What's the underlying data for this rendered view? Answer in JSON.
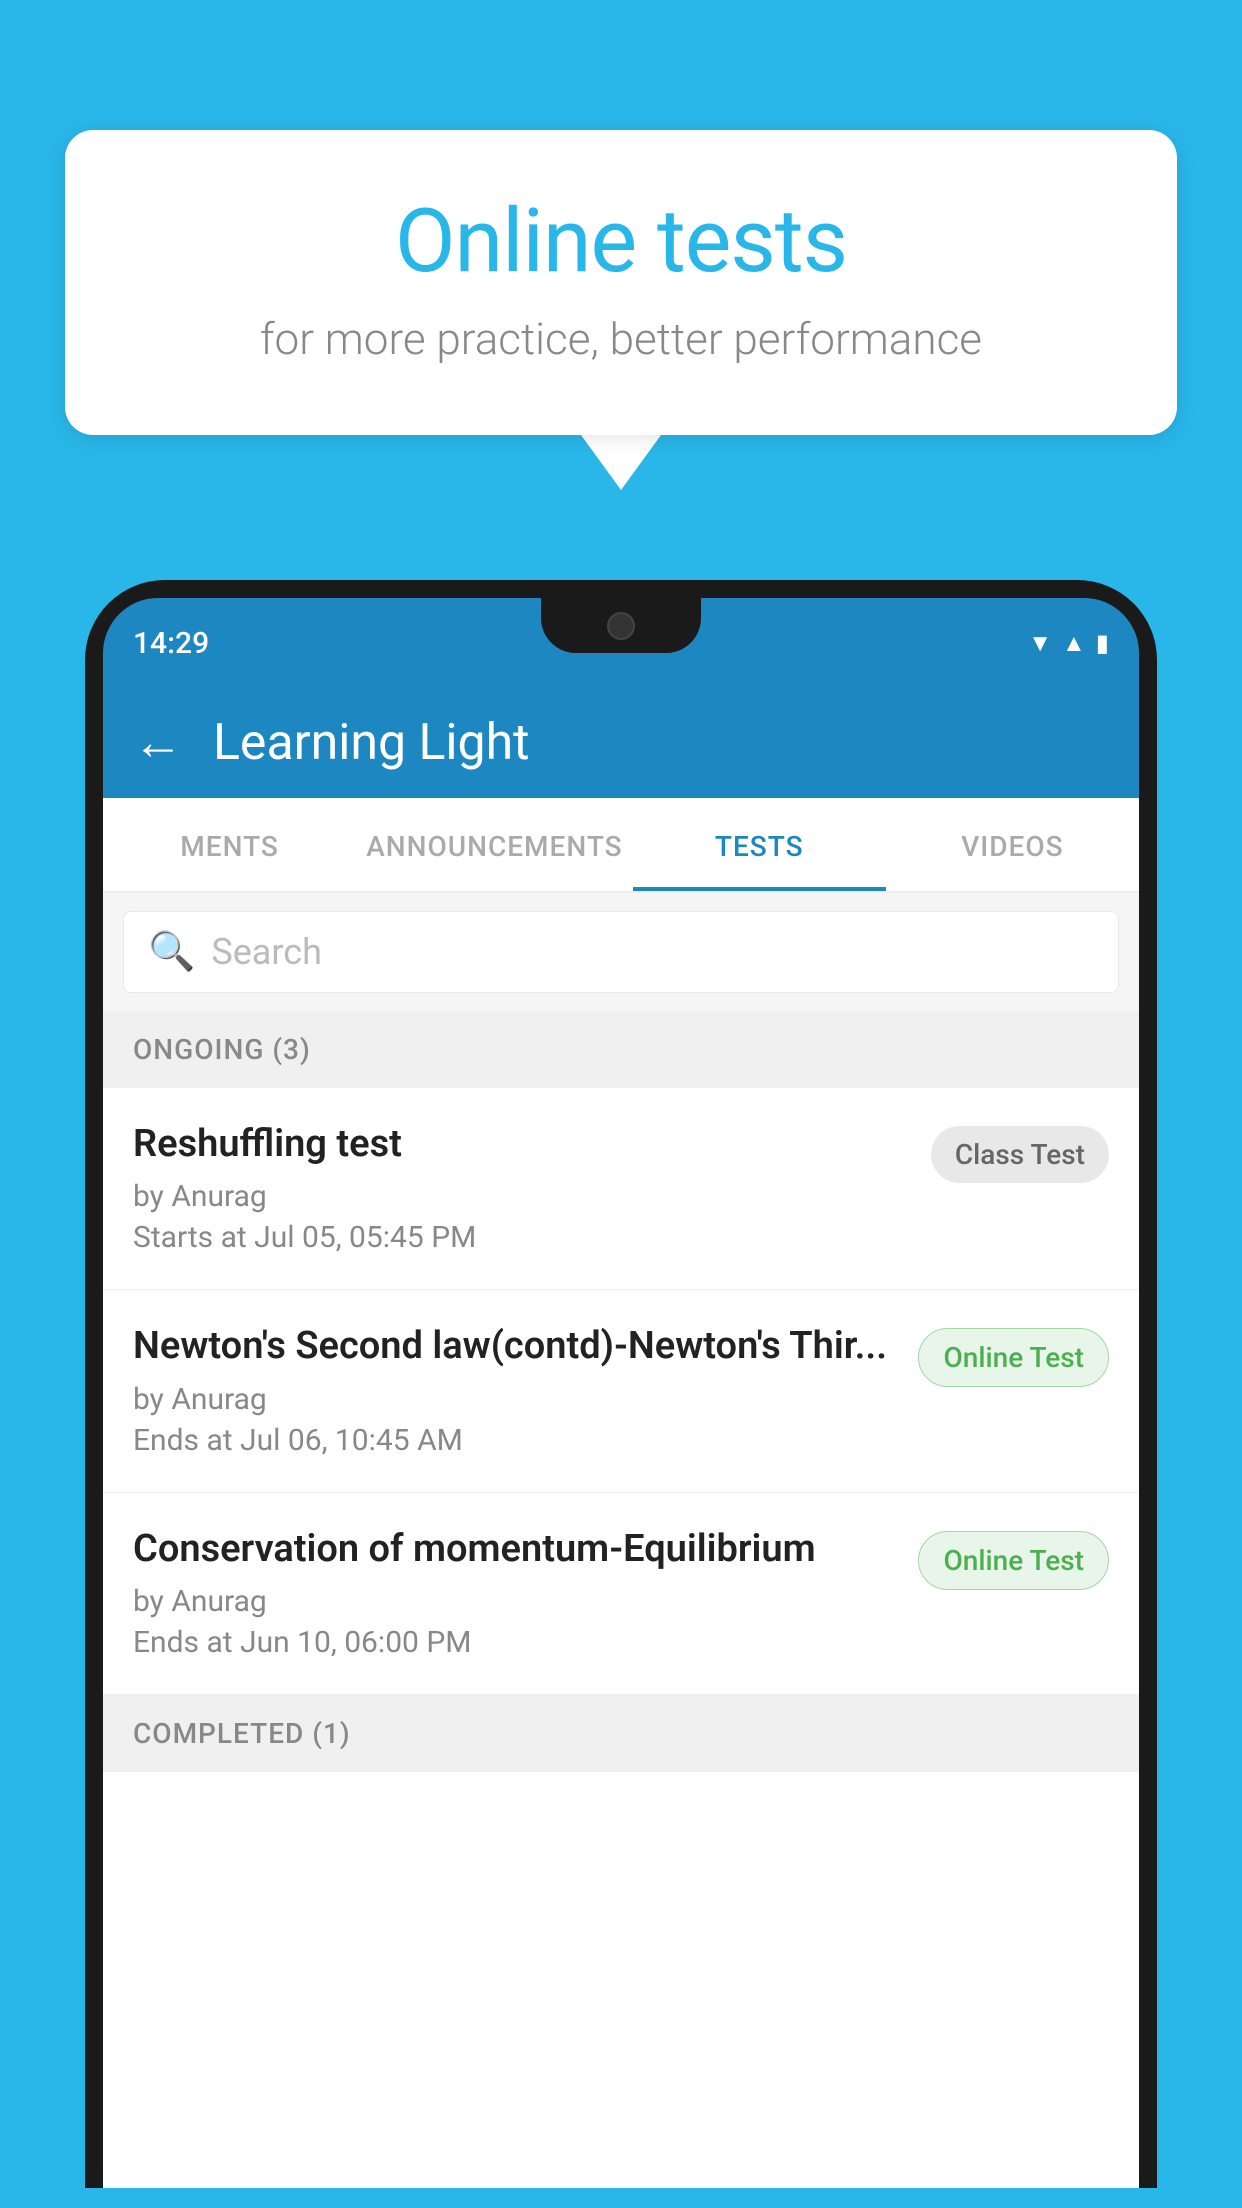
{
  "background_color": "#29b6e8",
  "speech_bubble": {
    "title": "Online tests",
    "subtitle": "for more practice, better performance"
  },
  "phone": {
    "time": "14:29",
    "app_name": "Learning Light",
    "back_label": "←"
  },
  "tabs": [
    {
      "label": "MENTS",
      "active": false
    },
    {
      "label": "ANNOUNCEMENTS",
      "active": false
    },
    {
      "label": "TESTS",
      "active": true
    },
    {
      "label": "VIDEOS",
      "active": false
    }
  ],
  "search": {
    "placeholder": "Search"
  },
  "ongoing_section": {
    "label": "ONGOING (3)"
  },
  "tests": [
    {
      "title": "Reshuffling test",
      "author": "by Anurag",
      "date": "Starts at  Jul 05, 05:45 PM",
      "badge": "Class Test",
      "badge_type": "class"
    },
    {
      "title": "Newton's Second law(contd)-Newton's Thir...",
      "author": "by Anurag",
      "date": "Ends at  Jul 06, 10:45 AM",
      "badge": "Online Test",
      "badge_type": "online"
    },
    {
      "title": "Conservation of momentum-Equilibrium",
      "author": "by Anurag",
      "date": "Ends at  Jun 10, 06:00 PM",
      "badge": "Online Test",
      "badge_type": "online"
    }
  ],
  "completed_section": {
    "label": "COMPLETED (1)"
  }
}
